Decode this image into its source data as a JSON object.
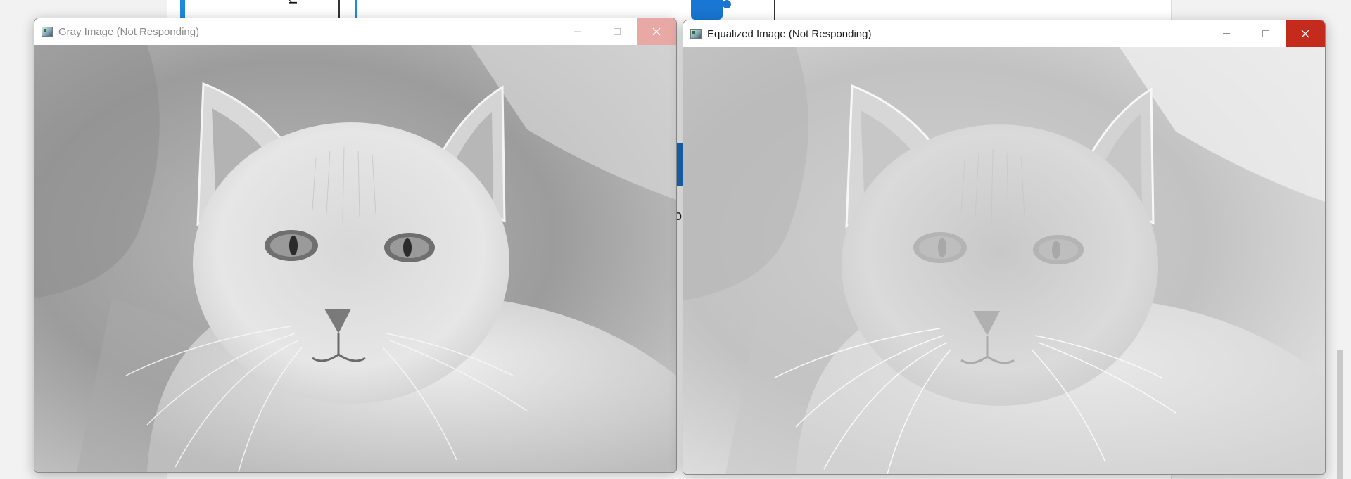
{
  "background_app": {
    "rotated_text": "nt",
    "edge_text": "o"
  },
  "windows": [
    {
      "title": "Gray Image (Not Responding)",
      "icon": "opencv-window-icon",
      "controls": [
        "minimize",
        "maximize",
        "close"
      ],
      "image": "grayscale-cat-photo"
    },
    {
      "title": "Equalized Image (Not Responding)",
      "icon": "opencv-window-icon",
      "controls": [
        "minimize",
        "maximize",
        "close"
      ],
      "image": "equalized-cat-photo"
    }
  ],
  "colors": {
    "close_active": "#c42b1c",
    "close_inactive": "#e8a8a5",
    "accent_blue": "#1e88e5"
  }
}
